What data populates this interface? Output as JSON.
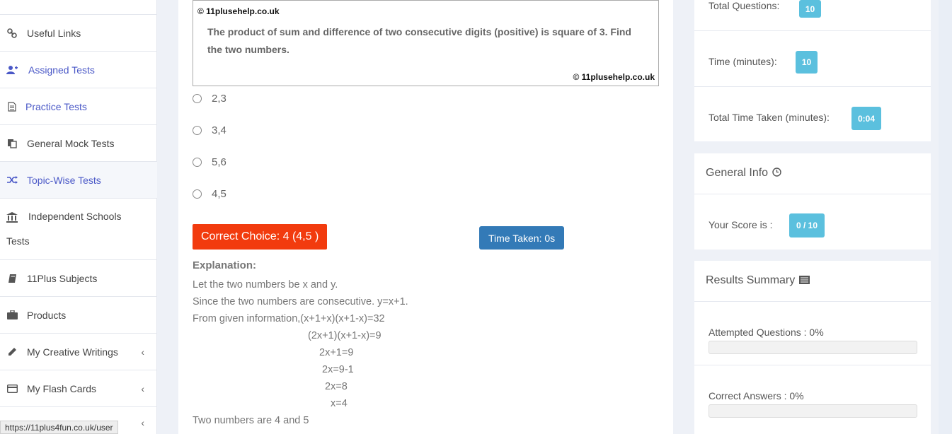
{
  "sidebar": {
    "items": [
      {
        "label": "Useful Links",
        "icon": "link-icon"
      },
      {
        "label": "Assigned Tests",
        "icon": "user-plus-icon"
      },
      {
        "label": "Practice Tests",
        "icon": "document-icon"
      },
      {
        "label": "General Mock Tests",
        "icon": "copy-icon"
      },
      {
        "label": "Topic-Wise Tests",
        "icon": "shuffle-icon"
      },
      {
        "label": "Independent Schools",
        "label2": "Tests",
        "icon": "bank-icon"
      },
      {
        "label": "11Plus Subjects",
        "icon": "book-icon"
      },
      {
        "label": "Products",
        "icon": "briefcase-icon"
      },
      {
        "label": "My Creative Writings",
        "icon": "pencil-icon"
      },
      {
        "label": "My Flash Cards",
        "icon": "credit-card-icon"
      }
    ]
  },
  "question": {
    "watermark_top": "© 11plusehelp.co.uk",
    "watermark_bottom": "© 11plusehelp.co.uk",
    "text": "The product of sum and difference of two consecutive digits (positive) is square of 3. Find the two numbers.",
    "options": [
      "2,3",
      "3,4",
      "5,6",
      "4,5"
    ]
  },
  "result": {
    "correct_choice": "Correct Choice: 4 (4,5 )",
    "time_taken": "Time Taken: 0s"
  },
  "explanation": {
    "title": "Explanation:",
    "lines": [
      "Let the two numbers be x and y.",
      "Since the two numbers are consecutive. y=x+1.",
      "From given information,(x+1+x)(x+1-x)=32",
      "(2x+1)(x+1-x)=9",
      "2x+1=9",
      "2x=9-1",
      "2x=8",
      "x=4",
      "Two numbers are 4 and 5"
    ]
  },
  "stats": {
    "total_questions_label": "Total Questions:",
    "total_questions_value": "10",
    "time_label": "Time (minutes):",
    "time_value": "10",
    "time_taken_label": "Total Time Taken (minutes):",
    "time_taken_value": "0:04"
  },
  "general_info": {
    "title": "General Info",
    "score_label": "Your Score is :",
    "score_value": "0 / 10"
  },
  "results_summary": {
    "title": "Results Summary",
    "attempted_label": "Attempted Questions : 0%",
    "attempted_pct": 0,
    "correct_label": "Correct Answers : 0%",
    "correct_pct": 0
  },
  "status_url": "https://11plus4fun.co.uk/user",
  "colors": {
    "accent_blue": "#4a58c7",
    "correct_red": "#f23b0e",
    "time_blue": "#337ab7",
    "badge_cyan": "#5bc0de"
  }
}
